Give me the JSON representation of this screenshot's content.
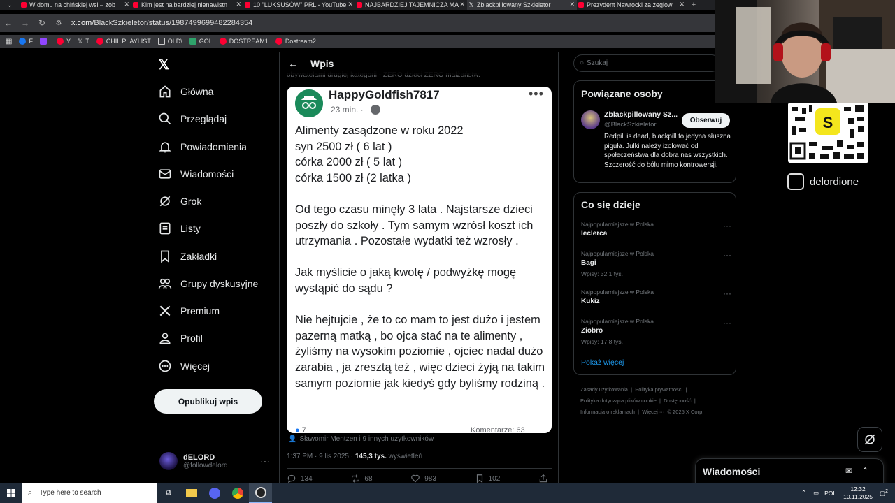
{
  "browser": {
    "tabs": [
      {
        "title": "W domu na chińskiej wsi – zob",
        "icon": "youtube-icon"
      },
      {
        "title": "Kim jest najbardziej nienawistn",
        "icon": "youtube-icon"
      },
      {
        "title": "10 \"LUKSUSÓW\" PRL - YouTube",
        "icon": "youtube-icon"
      },
      {
        "title": "NAJBARDZIEJ TAJEMNICZA MA",
        "icon": "youtube-icon"
      },
      {
        "title": "Zblackpillowany Szkieletor",
        "icon": "x-icon",
        "active": true
      },
      {
        "title": "Prezydent Nawrocki za żeglow",
        "icon": "youtube-icon"
      }
    ],
    "url_prefix": "x.com",
    "url_path": "/BlackSzkieletor/status/1987499699482284354",
    "bookmarks": [
      "F",
      "Y",
      "T",
      "CHIL PLAYLIST",
      "OLD\\",
      "GOL",
      "DOSTREAM1",
      "Dostream2"
    ]
  },
  "nav": {
    "items": [
      {
        "label": "Główna",
        "icon": "home-icon"
      },
      {
        "label": "Przeglądaj",
        "icon": "search-icon"
      },
      {
        "label": "Powiadomienia",
        "icon": "bell-icon"
      },
      {
        "label": "Wiadomości",
        "icon": "mail-icon"
      },
      {
        "label": "Grok",
        "icon": "grok-icon"
      },
      {
        "label": "Listy",
        "icon": "list-icon"
      },
      {
        "label": "Zakładki",
        "icon": "bookmark-icon"
      },
      {
        "label": "Grupy dyskusyjne",
        "icon": "people-icon"
      },
      {
        "label": "Premium",
        "icon": "x-icon"
      },
      {
        "label": "Profil",
        "icon": "person-icon"
      },
      {
        "label": "Więcej",
        "icon": "more-circle-icon"
      }
    ],
    "post_button": "Opublikuj wpis",
    "account": {
      "name": "dELORD",
      "handle": "@followdelord"
    }
  },
  "main": {
    "title": "Wpis",
    "prev_text": "obywatelami drugiej kategorii - ZERO dzieci ZERO małżeństw.",
    "fb_post": {
      "author": "HappyGoldfish7817",
      "time": "23 min. ·",
      "body": "Alimenty zasądzone w roku 2022\nsyn 2500 zł ( 6 lat )\ncórka 2000 zł ( 5 lat )\ncórka 1500 zł (2 latka )\n\nOd tego czasu minęły 3 lata . Najstarsze dzieci poszły do szkoły . Tym samym wzrósł koszt ich utrzymania . Pozostałe wydatki też wzrosły .\n\nJak myślicie o jaką kwotę / podwyżkę mogę wystąpić do sądu ?\n\nNie hejtujcie , że to co mam to jest dużo i jestem pazerną matką , bo ojca stać na te alimenty , żyliśmy na wysokim poziomie , ojciec nadal dużo zarabia , ja zresztą też , więc dzieci żyją na takim samym poziomie jak kiedyś gdy byliśmy rodziną .",
      "reactions": "7",
      "comments": "Komentarze: 63"
    },
    "liked_by": "Sławomir Mentzen i 9 innych użytkowników",
    "time": "1:37 PM · 9 lis 2025 ·",
    "views_count": "145,3 tys.",
    "views_label": "wyświetleń",
    "actions": {
      "replies": "134",
      "reposts": "68",
      "likes": "983",
      "bookmarks": "102"
    }
  },
  "right": {
    "search_placeholder": "Szukaj",
    "related": {
      "title": "Powiązane osoby",
      "name": "Zblackpillowany Sz...",
      "handle": "@BlackSzkieletor",
      "follow": "Obserwuj",
      "bio": "Redpill is dead, blackpill to jedyna słuszna piguła. Julki należy izolować od społeczeństwa dla dobra nas wszystkich. Szczerość do bólu mimo kontrowersji."
    },
    "trends": {
      "title": "Co się dzieje",
      "items": [
        {
          "context": "Najpopularniejsze w Polska",
          "name": "leclerca",
          "count": ""
        },
        {
          "context": "Najpopularniejsze w Polska",
          "name": "Bagi",
          "count": "Wpisy: 32,1 tys."
        },
        {
          "context": "Najpopularniejsze w Polska",
          "name": "Kukiz",
          "count": ""
        },
        {
          "context": "Najpopularniejsze w Polska",
          "name": "Ziobro",
          "count": "Wpisy: 17,8 tys."
        }
      ],
      "show_more": "Pokaż więcej"
    },
    "footer": {
      "l1": "Zasady użytkowania",
      "l2": "Polityka prywatności",
      "l3": "Polityka dotycząca plików cookie",
      "l4": "Dostępność",
      "l5": "Informacja o reklamach",
      "l6": "Więcej ···",
      "copyright": "© 2025 X Corp."
    }
  },
  "overlay": {
    "streamer_handle": "delordione"
  },
  "messages": {
    "title": "Wiadomości"
  },
  "taskbar": {
    "search_placeholder": "Type here to search",
    "lang": "POL",
    "time": "12:32",
    "date": "10.11.2025",
    "notif": "2"
  }
}
